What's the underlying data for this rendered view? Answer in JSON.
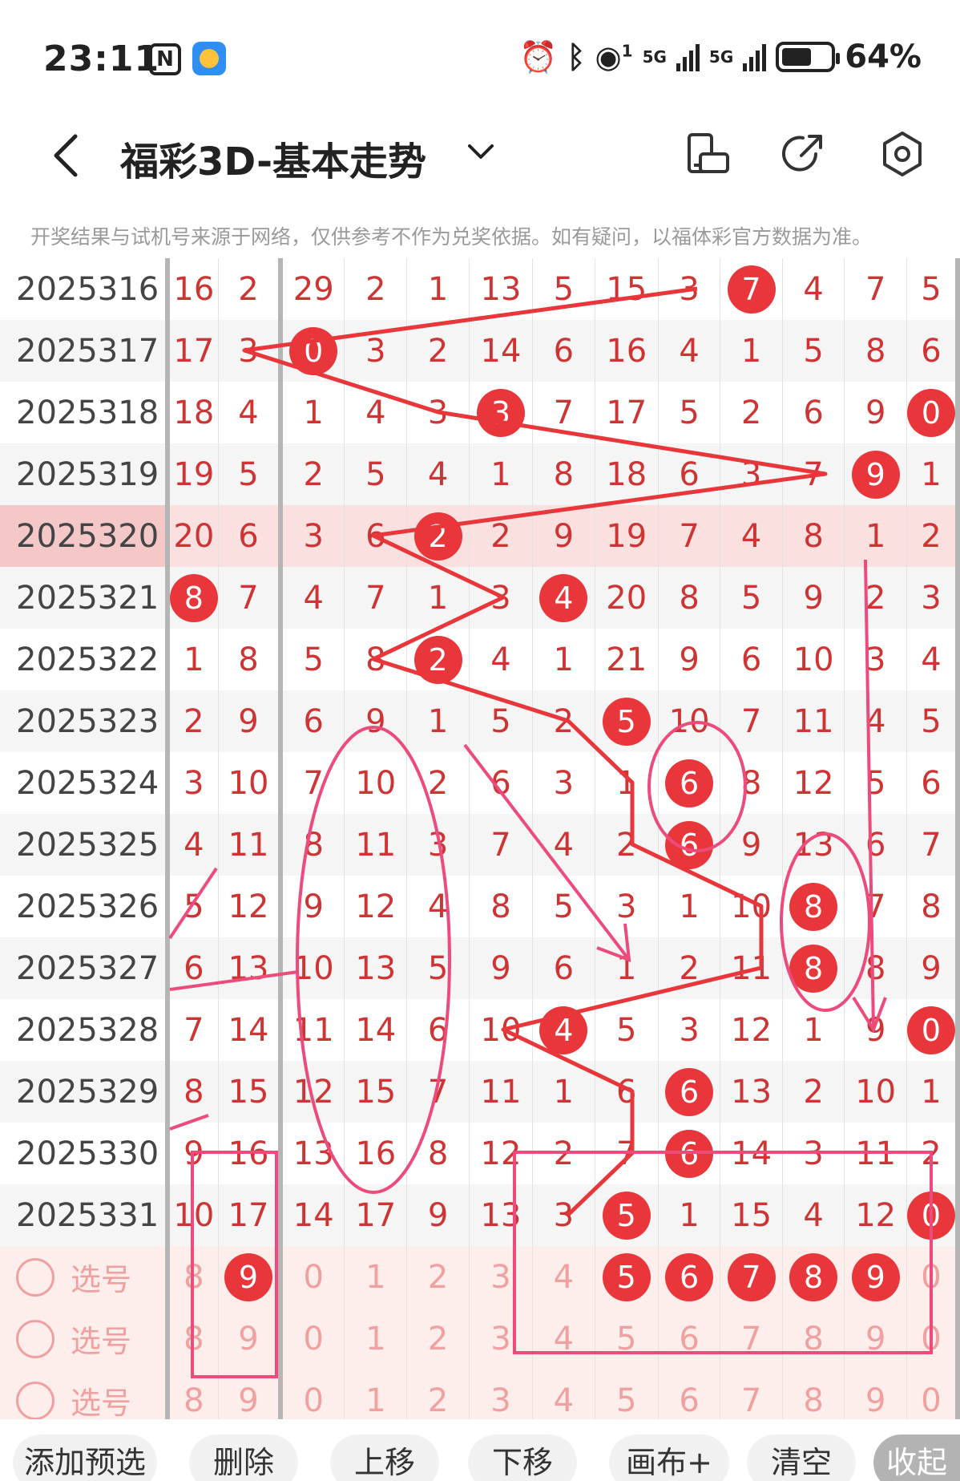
{
  "status": {
    "time": "23:11",
    "battery": "64%",
    "sim1": "5G",
    "sim2": "5G",
    "hotspot_count": "1"
  },
  "nav": {
    "title": "福彩3D-基本走势"
  },
  "disclaimer": "开奖结果与试机号来源于网络，仅供参考不作为兑奖依据。如有疑问，以福体彩官方数据为准。",
  "grid": {
    "rows": [
      {
        "issue": "2025316",
        "cells": [
          "16",
          "2",
          "29",
          "2",
          "1",
          "13",
          "5",
          "15",
          "3",
          "7",
          "4",
          "7",
          "5"
        ],
        "hit": 9
      },
      {
        "issue": "2025317",
        "cells": [
          "17",
          "3",
          "0",
          "3",
          "2",
          "14",
          "6",
          "16",
          "4",
          "1",
          "5",
          "8",
          "6"
        ],
        "hit": 2
      },
      {
        "issue": "2025318",
        "cells": [
          "18",
          "4",
          "1",
          "4",
          "3",
          "3",
          "7",
          "17",
          "5",
          "2",
          "6",
          "9",
          "0"
        ],
        "hit": 5,
        "hit2": 12
      },
      {
        "issue": "2025319",
        "cells": [
          "19",
          "5",
          "2",
          "5",
          "4",
          "1",
          "8",
          "18",
          "6",
          "3",
          "7",
          "9",
          "1"
        ],
        "hit": 11
      },
      {
        "issue": "2025320",
        "cells": [
          "20",
          "6",
          "3",
          "6",
          "2",
          "2",
          "9",
          "19",
          "7",
          "4",
          "8",
          "1",
          "2"
        ],
        "hit": 4
      },
      {
        "issue": "2025321",
        "cells": [
          "8",
          "7",
          "4",
          "7",
          "1",
          "3",
          "4",
          "20",
          "8",
          "5",
          "9",
          "2",
          "3"
        ],
        "hit": 6,
        "hit2": 0
      },
      {
        "issue": "2025322",
        "cells": [
          "1",
          "8",
          "5",
          "8",
          "2",
          "4",
          "1",
          "21",
          "9",
          "6",
          "10",
          "3",
          "4"
        ],
        "hit": 4
      },
      {
        "issue": "2025323",
        "cells": [
          "2",
          "9",
          "6",
          "9",
          "1",
          "5",
          "2",
          "5",
          "10",
          "7",
          "11",
          "4",
          "5"
        ],
        "hit": 7
      },
      {
        "issue": "2025324",
        "cells": [
          "3",
          "10",
          "7",
          "10",
          "2",
          "6",
          "3",
          "1",
          "6",
          "8",
          "12",
          "5",
          "6"
        ],
        "hit": 8
      },
      {
        "issue": "2025325",
        "cells": [
          "4",
          "11",
          "8",
          "11",
          "3",
          "7",
          "4",
          "2",
          "6",
          "9",
          "13",
          "6",
          "7"
        ],
        "hit": 8
      },
      {
        "issue": "2025326",
        "cells": [
          "5",
          "12",
          "9",
          "12",
          "4",
          "8",
          "5",
          "3",
          "1",
          "10",
          "8",
          "7",
          "8"
        ],
        "hit": 10
      },
      {
        "issue": "2025327",
        "cells": [
          "6",
          "13",
          "10",
          "13",
          "5",
          "9",
          "6",
          "1",
          "2",
          "11",
          "8",
          "8",
          "9"
        ],
        "hit": 10
      },
      {
        "issue": "2025328",
        "cells": [
          "7",
          "14",
          "11",
          "14",
          "6",
          "10",
          "4",
          "5",
          "3",
          "12",
          "1",
          "9",
          "0"
        ],
        "hit": 6,
        "hit2": 12
      },
      {
        "issue": "2025329",
        "cells": [
          "8",
          "15",
          "12",
          "15",
          "7",
          "11",
          "1",
          "6",
          "6",
          "13",
          "2",
          "10",
          "1"
        ],
        "hit": 8
      },
      {
        "issue": "2025330",
        "cells": [
          "9",
          "16",
          "13",
          "16",
          "8",
          "12",
          "2",
          "7",
          "6",
          "14",
          "3",
          "11",
          "2"
        ],
        "hit": 8
      },
      {
        "issue": "2025331",
        "cells": [
          "10",
          "17",
          "14",
          "17",
          "9",
          "13",
          "3",
          "5",
          "1",
          "15",
          "4",
          "12",
          "0"
        ],
        "hit": 7,
        "hit2": 12
      }
    ],
    "pick_rows": [
      {
        "label": "选号",
        "cells": [
          "8",
          "9",
          "0",
          "1",
          "2",
          "3",
          "4",
          "5",
          "6",
          "7",
          "8",
          "9",
          "0"
        ],
        "selected": [
          1,
          7,
          8,
          9,
          10,
          11
        ]
      },
      {
        "label": "选号",
        "cells": [
          "8",
          "9",
          "0",
          "1",
          "2",
          "3",
          "4",
          "5",
          "6",
          "7",
          "8",
          "9",
          "0"
        ],
        "selected": []
      },
      {
        "label": "选号",
        "cells": [
          "8",
          "9",
          "0",
          "1",
          "2",
          "3",
          "4",
          "5",
          "6",
          "7",
          "8",
          "9",
          "0"
        ],
        "selected": []
      }
    ]
  },
  "toolbar": {
    "add": "添加预选",
    "delete": "删除",
    "up": "上移",
    "down": "下移",
    "canvas": "画布+",
    "clear": "清空",
    "collapse": "收起"
  },
  "colors": {
    "hit": "#e8363a",
    "accent": "#cf3434",
    "annotation": "#ec4b7c",
    "highlight_row": "#fbe0e0"
  }
}
